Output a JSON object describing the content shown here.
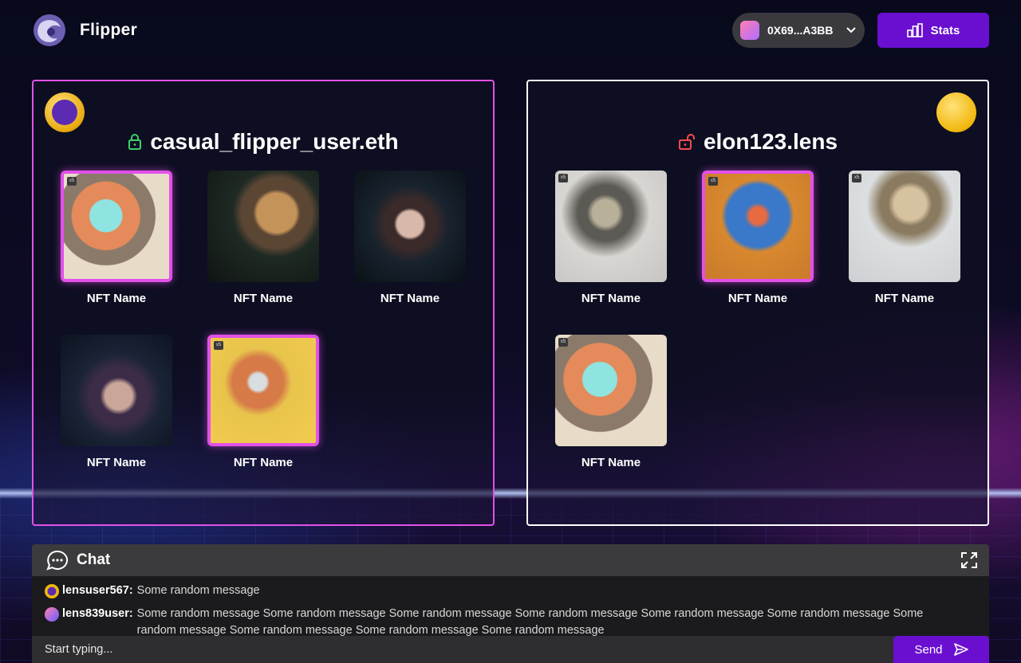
{
  "header": {
    "brand": "Flipper",
    "wallet_address": "0X69...A3BB",
    "stats_label": "Stats"
  },
  "left_panel": {
    "username": "casual_flipper_user.eth",
    "lock_state": "locked",
    "nfts": [
      {
        "name": "NFT Name",
        "badge": "x5",
        "selected": true
      },
      {
        "name": "NFT Name",
        "selected": false
      },
      {
        "name": "NFT Name",
        "selected": false
      },
      {
        "name": "NFT Name",
        "selected": false
      },
      {
        "name": "NFT Name",
        "badge": "x5",
        "selected": true
      }
    ]
  },
  "right_panel": {
    "username": "elon123.lens",
    "lock_state": "unlocked",
    "nfts": [
      {
        "name": "NFT Name",
        "badge": "x5",
        "selected": false
      },
      {
        "name": "NFT Name",
        "badge": "x5",
        "selected": true
      },
      {
        "name": "NFT Name",
        "badge": "x5",
        "selected": false
      },
      {
        "name": "NFT Name",
        "badge": "x5",
        "selected": false
      }
    ]
  },
  "chat": {
    "title": "Chat",
    "messages": [
      {
        "user": "lensuser567:",
        "text": "Some random message"
      },
      {
        "user": "lens839user:",
        "text": "Some random message Some random message Some random message Some random message Some random message Some random message Some random message Some random message Some random message Some random message"
      }
    ],
    "input_placeholder": "Start typing...",
    "send_label": "Send"
  },
  "colors": {
    "accent_purple": "#6a0fd0",
    "selected_border": "#e251e8",
    "locked_icon": "#3ad16a",
    "unlocked_icon": "#ff4a4a"
  }
}
